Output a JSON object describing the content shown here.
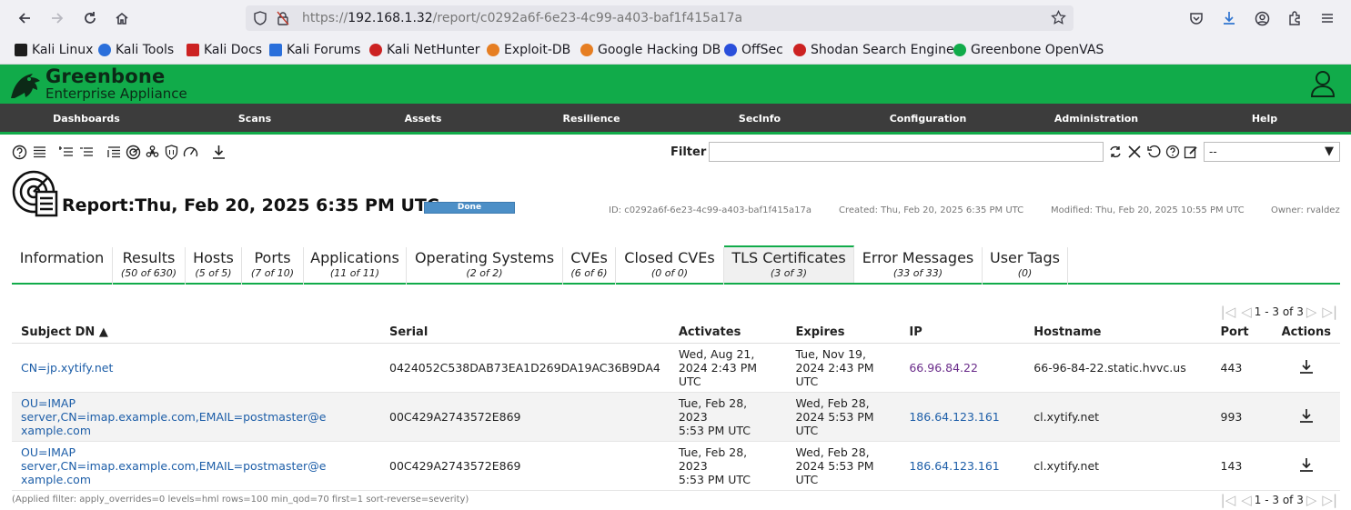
{
  "browser": {
    "url_scheme": "https://",
    "url_host": "192.168.1.32",
    "url_path": "/report/c0292a6f-6e23-4c99-a403-baf1f415a17a",
    "bookmarks": [
      "Kali Linux",
      "Kali Tools",
      "Kali Docs",
      "Kali Forums",
      "Kali NetHunter",
      "Exploit-DB",
      "Google Hacking DB",
      "OffSec",
      "Shodan Search Engine",
      "Greenbone OpenVAS"
    ]
  },
  "header": {
    "brand_line1": "Greenbone",
    "brand_line2": "Enterprise Appliance"
  },
  "menu": [
    "Dashboards",
    "Scans",
    "Assets",
    "Resilience",
    "SecInfo",
    "Configuration",
    "Administration",
    "Help"
  ],
  "filter": {
    "label": "Filter",
    "value": "",
    "select_value": "--"
  },
  "report": {
    "title": "Report:Thu, Feb 20, 2025 6:35 PM UTC",
    "status": "Done",
    "id": "ID: c0292a6f-6e23-4c99-a403-baf1f415a17a",
    "created": "Created: Thu, Feb 20, 2025 6:35 PM UTC",
    "modified": "Modified: Thu, Feb 20, 2025 10:55 PM UTC",
    "owner": "Owner: rvaldez"
  },
  "tabs": [
    {
      "label": "Information",
      "count": ""
    },
    {
      "label": "Results",
      "count": "(50 of 630)"
    },
    {
      "label": "Hosts",
      "count": "(5 of 5)"
    },
    {
      "label": "Ports",
      "count": "(7 of 10)"
    },
    {
      "label": "Applications",
      "count": "(11 of 11)"
    },
    {
      "label": "Operating Systems",
      "count": "(2 of 2)"
    },
    {
      "label": "CVEs",
      "count": "(6 of 6)"
    },
    {
      "label": "Closed CVEs",
      "count": "(0 of 0)"
    },
    {
      "label": "TLS Certificates",
      "count": "(3 of 3)"
    },
    {
      "label": "Error Messages",
      "count": "(33 of 33)"
    },
    {
      "label": "User Tags",
      "count": "(0)"
    }
  ],
  "pagination": {
    "text": "1 - 3 of 3"
  },
  "table": {
    "headers": {
      "subject_dn": "Subject DN ▲",
      "serial": "Serial",
      "activates": "Activates",
      "expires": "Expires",
      "ip": "IP",
      "hostname": "Hostname",
      "port": "Port",
      "actions": "Actions"
    },
    "rows": [
      {
        "subject_dn_1": "CN=jp.xytify.net",
        "subject_dn_2": "",
        "serial": "0424052C538DAB73EA1D269DA19AC36B9DA4",
        "activates_1": "Wed, Aug 21,",
        "activates_2": "2024 2:43 PM UTC",
        "expires_1": "Tue, Nov 19,",
        "expires_2": "2024 2:43 PM",
        "expires_3": "UTC",
        "ip": "66.96.84.22",
        "hostname": "66-96-84-22.static.hvvc.us",
        "port": "443"
      },
      {
        "subject_dn_1": "OU=IMAP server,CN=imap.example.com,EMAIL=postmaster@e",
        "subject_dn_2": "xample.com",
        "serial": "00C429A2743572E869",
        "activates_1": "Tue, Feb 28, 2023",
        "activates_2": "5:53 PM UTC",
        "expires_1": "Wed, Feb 28,",
        "expires_2": "2024 5:53 PM",
        "expires_3": "UTC",
        "ip": "186.64.123.161",
        "hostname": "cl.xytify.net",
        "port": "993"
      },
      {
        "subject_dn_1": "OU=IMAP server,CN=imap.example.com,EMAIL=postmaster@e",
        "subject_dn_2": "xample.com",
        "serial": "00C429A2743572E869",
        "activates_1": "Tue, Feb 28, 2023",
        "activates_2": "5:53 PM UTC",
        "expires_1": "Wed, Feb 28,",
        "expires_2": "2024 5:53 PM",
        "expires_3": "UTC",
        "ip": "186.64.123.161",
        "hostname": "cl.xytify.net",
        "port": "143"
      }
    ]
  },
  "applied_filter": "(Applied filter: apply_overrides=0 levels=hml rows=100 min_qod=70 first=1 sort-reverse=severity)",
  "colors": {
    "brand_green": "#11ab4a",
    "menu_bg": "#3c3c3c",
    "status_blue": "#4c8fc7",
    "link_blue": "#1d5ea8"
  }
}
